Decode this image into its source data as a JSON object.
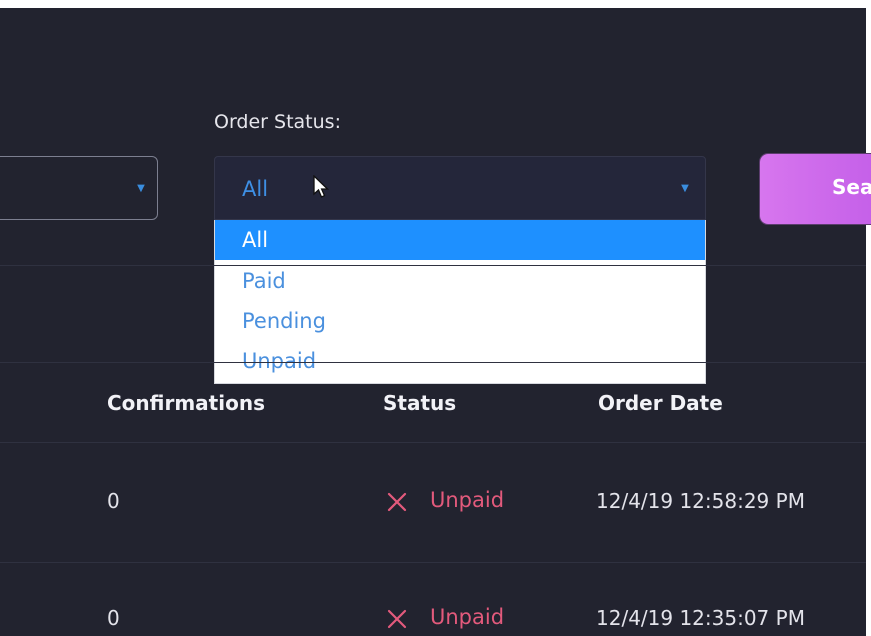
{
  "filters": {
    "order_status_label": "Order Status:",
    "order_status_value": "All",
    "order_status_options": [
      "All",
      "Paid",
      "Pending",
      "Unpaid"
    ],
    "search_button_label": "Sea"
  },
  "table": {
    "headers": [
      "Confirmations",
      "Status",
      "Order Date"
    ],
    "rows": [
      {
        "confirmations": "0",
        "status": "Unpaid",
        "order_date": "12/4/19 12:58:29 PM"
      },
      {
        "confirmations": "0",
        "status": "Unpaid",
        "order_date": "12/4/19 12:35:07 PM"
      }
    ]
  },
  "colors": {
    "background": "#22232f",
    "accent_blue": "#1e90ff",
    "unpaid_red": "#e35a7c",
    "button_purple": "#d776ee"
  },
  "icons": {
    "select_arrow": "chevron-down-icon",
    "status_unpaid": "x-icon",
    "cursor": "mouse-cursor-icon"
  }
}
